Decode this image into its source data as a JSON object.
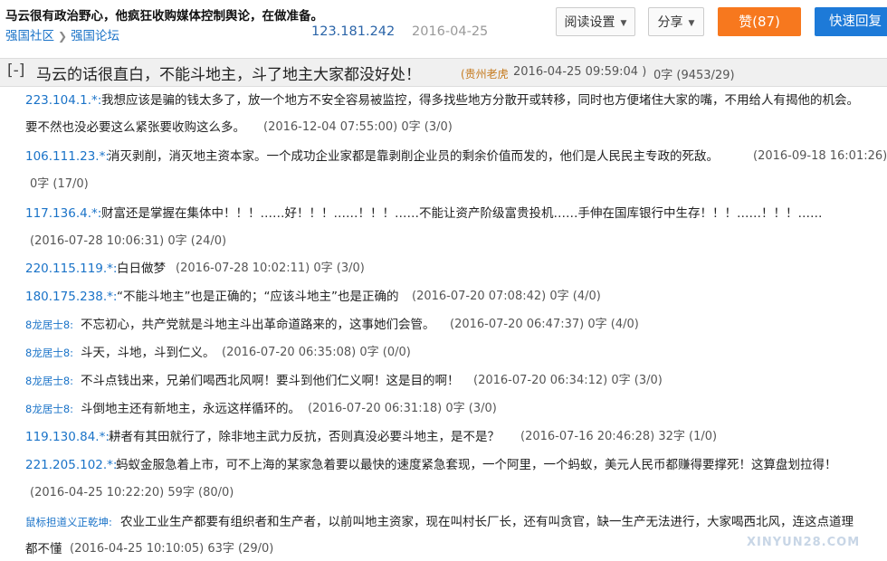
{
  "header": {
    "title": "马云很有政治野心，他疯狂收购媒体控制舆论，在做准备。",
    "breadcrumb": [
      "强国社区",
      "强国论坛"
    ],
    "ip": "123.181.242",
    "date": "2016-04-25",
    "read_settings": "阅读设置",
    "share": "分享",
    "like": "赞(87)",
    "quick_reply": "快速回复"
  },
  "main_post": {
    "toggle": "[-]",
    "text": "马云的话很直白，不能斗地主，斗了地主大家都没好处！",
    "author": "(贵州老虎",
    "time": "2016-04-25 09:59:04 )",
    "count": "0字 (9453/29)"
  },
  "replies": [
    {
      "author": "223.104.1.*:",
      "line1": "我想应该是骗的钱太多了，放一个地方不安全容易被监控，得多找些地方分散开或转移，同时也方便堵住大家的嘴，不用给人有揭他的机会。",
      "line2": "要不然也没必要这么紧张要收购这么多。",
      "meta": "(2016-12-04 07:55:00)  0字 (3/0)"
    },
    {
      "author": "106.111.23.*:",
      "line1": "消灭剥削，消灭地主资本家。一个成功企业家都是靠剥削企业员的剩余价值而发的，他们是人民民主专政的死敌。",
      "meta_inline": "(2016-09-18 16:01:26)",
      "line2": "0字 (17/0)"
    },
    {
      "author": "117.136.4.*:",
      "line1": "财富还是掌握在集体中！！！……好！！！……！！！……不能让资产阶级富贵投机……手伸在国库银行中生存！！！……！！！……",
      "line2": "(2016-07-28 10:06:31)  0字 (24/0)"
    },
    {
      "author": "220.115.119.*:",
      "body": "白日做梦",
      "meta": "(2016-07-28 10:02:11)  0字 (3/0)"
    },
    {
      "author": "180.175.238.*:",
      "body": "“不能斗地主”也是正确的；“应该斗地主”也是正确的",
      "meta": "(2016-07-20 07:08:42)  0字 (4/0)"
    },
    {
      "author": "8龙居士8:",
      "body": "不忘初心，共产党就是斗地主斗出革命道路来的，这事她们会管。",
      "meta": "(2016-07-20 06:47:37)  0字 (4/0)"
    },
    {
      "author": "8龙居士8:",
      "body": "斗天，斗地，斗到仁义。",
      "meta": "(2016-07-20 06:35:08)  0字 (0/0)"
    },
    {
      "author": "8龙居士8:",
      "body": "不斗点钱出来，兄弟们喝西北风啊！要斗到他们仁义啊！这是目的啊！",
      "meta": "(2016-07-20 06:34:12)  0字 (3/0)"
    },
    {
      "author": "8龙居士8:",
      "body": "斗倒地主还有新地主，永远这样循环的。",
      "meta": "(2016-07-20 06:31:18)  0字 (3/0)"
    },
    {
      "author": "119.130.84.*:",
      "body": "耕者有其田就行了，除非地主武力反抗，否则真没必要斗地主，是不是？",
      "meta": "(2016-07-16 20:46:28)  32字 (1/0)"
    },
    {
      "author": "221.205.102.*:",
      "line1": "蚂蚁金服急着上市，可不上海的某家急着要以最快的速度紧急套现，一个阿里，一个蚂蚁，美元人民币都赚得要撑死！这算盘划拉得！",
      "line2": "(2016-04-25 10:22:20)  59字 (80/0)"
    },
    {
      "author": "鼠标担道义正乾坤:",
      "line1": "农业工业生产都要有组织者和生产者，以前叫地主资家，现在叫村长厂长，还有叫贪官，缺一生产无法进行，大家喝西北风，连这点道理",
      "line2": "都不懂",
      "meta": "(2016-04-25 10:10:05)  63字 (29/0)"
    }
  ],
  "watermark": "XINYUN28.COM"
}
